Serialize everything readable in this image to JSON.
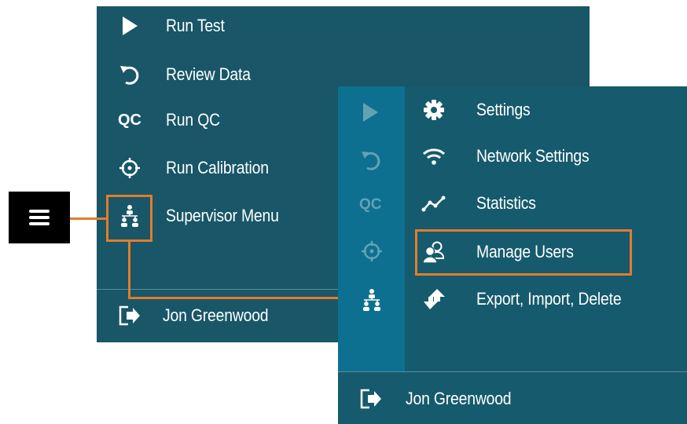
{
  "main_menu": {
    "items": [
      {
        "label": "Run Test",
        "icon": "play-icon"
      },
      {
        "label": "Review Data",
        "icon": "undo-arrow-icon"
      },
      {
        "label": "Run QC",
        "icon": "qc-icon",
        "icon_text": "QC"
      },
      {
        "label": "Run Calibration",
        "icon": "crosshair-icon"
      },
      {
        "label": "Supervisor Menu",
        "icon": "org-chart-icon"
      }
    ],
    "user_name": "Jon Greenwood"
  },
  "supervisor_menu": {
    "rail_qc_text": "QC",
    "items": [
      {
        "label": "Settings",
        "icon": "gear-icon"
      },
      {
        "label": "Network Settings",
        "icon": "wifi-icon"
      },
      {
        "label": "Statistics",
        "icon": "chart-line-icon"
      },
      {
        "label": "Manage Users",
        "icon": "users-icon"
      },
      {
        "label": "Export, Import, Delete",
        "icon": "transfer-arrows-icon"
      }
    ],
    "user_name": "Jon Greenwood"
  },
  "colors": {
    "panel": "#185668",
    "rail": "#0d7090",
    "highlight": "#e27c2c",
    "hamburger_bg": "#000000"
  }
}
